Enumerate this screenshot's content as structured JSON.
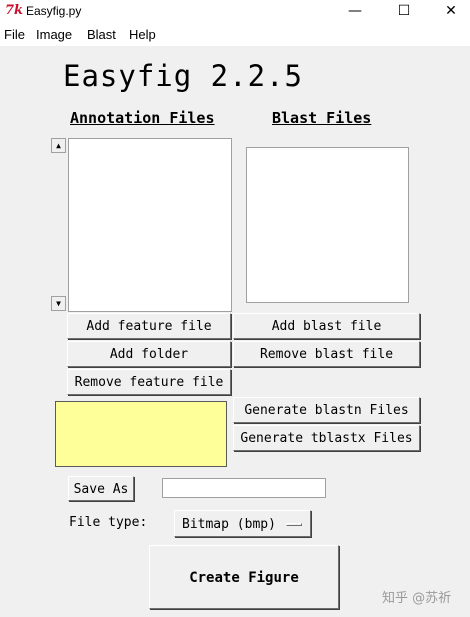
{
  "window": {
    "title": "Easyfig.py",
    "app_icon_glyph": "7k",
    "controls": {
      "minimize": "—",
      "maximize": "☐",
      "close": "✕"
    }
  },
  "menu": [
    "File",
    "Image",
    "Blast",
    "Help"
  ],
  "app_title": "Easyfig 2.2.5",
  "annotation": {
    "heading": "Annotation Files",
    "scroll_up": "▲",
    "scroll_down": "▼"
  },
  "blast": {
    "heading": "Blast Files"
  },
  "buttons": {
    "add_feature_file": "Add feature file",
    "add_folder": "Add folder",
    "remove_feature_file": "Remove feature file",
    "add_blast_file": "Add blast file",
    "remove_blast_file": "Remove blast file",
    "generate_blastn": "Generate blastn Files",
    "generate_tblastx": "Generate tblastx Files",
    "save_as": "Save As",
    "create_figure": "Create Figure"
  },
  "save_path": "",
  "file_type": {
    "label": "File type:",
    "selected": "Bitmap (bmp)"
  },
  "watermark": "知乎 @苏祈",
  "colors": {
    "window_bg": "#f0f0f0",
    "status_box": "#ffff99",
    "tk_icon": "#c8102e"
  }
}
